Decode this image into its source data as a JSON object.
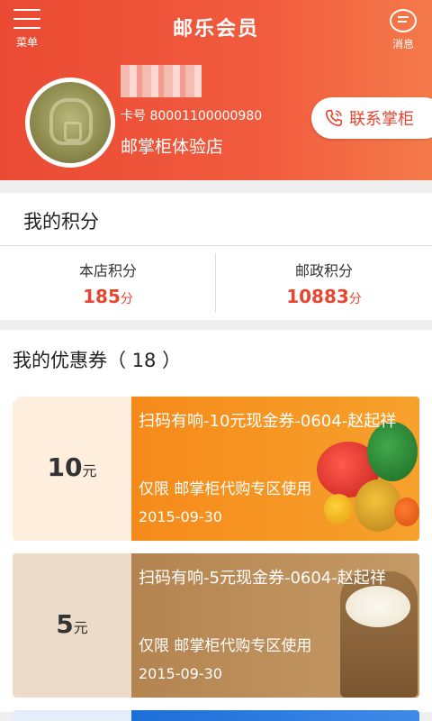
{
  "header": {
    "menu_label": "菜单",
    "title": "邮乐会员",
    "message_label": "消息"
  },
  "member": {
    "card_number": "卡号 80001100000980",
    "shop_name": "邮掌柜体验店",
    "contact_label": "联系掌柜"
  },
  "points": {
    "section_title": "我的积分",
    "items": [
      {
        "name": "本店积分",
        "value": "185",
        "unit": "分"
      },
      {
        "name": "邮政积分",
        "value": "10883",
        "unit": "分"
      }
    ]
  },
  "coupons": {
    "section_title": "我的优惠券（ 18 ）",
    "items": [
      {
        "amount": "10",
        "unit": "元",
        "title": "扫码有响-10元现金券-0604-赵起祥",
        "limit": "仅限 邮掌柜代购专区使用",
        "date": "2015-09-30"
      },
      {
        "amount": "5",
        "unit": "元",
        "title": "扫码有响-5元现金券-0604-赵起祥",
        "limit": "仅限 邮掌柜代购专区使用",
        "date": "2015-09-30"
      }
    ]
  },
  "colors": {
    "brand": "#e8462f",
    "coupon_orange": "#f58a1a",
    "coupon_brown": "#b48450",
    "coupon_blue": "#1e6ed8"
  }
}
